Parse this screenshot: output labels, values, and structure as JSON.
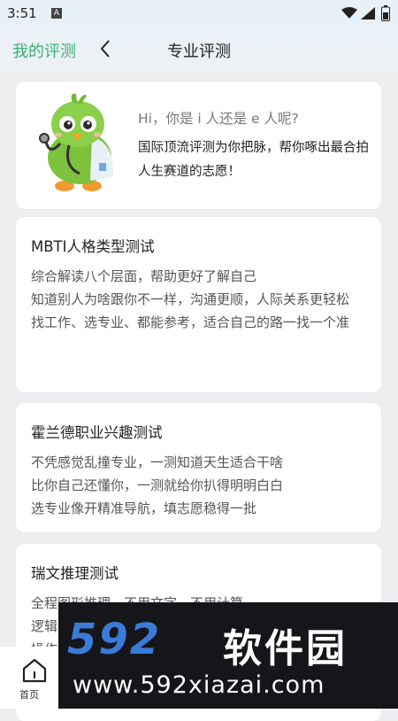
{
  "status_bar": {
    "time": "3:51",
    "a_icon": "A"
  },
  "header": {
    "my_eval": "我的评测",
    "title": "专业评测"
  },
  "intro": {
    "greeting": "Hi，你是 i 人还是 e 人呢?",
    "description": "国际顶流评测为你把脉，帮你啄出最合拍人生赛道的志愿！"
  },
  "tests": [
    {
      "title": "MBTI人格类型测试",
      "lines": [
        "综合解读八个层面，帮助更好了解自己",
        "知道别人为啥跟你不一样，沟通更顺，人际关系更轻松",
        "找工作、选专业、都能参考，适合自己的路一找一个准"
      ]
    },
    {
      "title": "霍兰德职业兴趣测试",
      "lines": [
        "不凭感觉乱撞专业，一测知道天生适合干啥",
        "比你自己还懂你，一测就给你扒得明明白白",
        "选专业像开精准导航，填志愿稳得一批"
      ]
    },
    {
      "title": "瑞文推理测试",
      "lines": [
        "全程图形推理，不用文字，不用计算",
        "逻辑",
        "操作"
      ]
    }
  ],
  "bottom_nav": {
    "home_label": "首页"
  },
  "watermark": {
    "logo": "592",
    "cn": "软件园",
    "url": "www.592xiazai.com"
  },
  "colors": {
    "accent_green": "#3bb074",
    "watermark_blue": "#3a7bd8"
  },
  "icons": [
    "wifi-icon",
    "signal-icon",
    "battery-icon",
    "back-icon",
    "home-icon",
    "mascot-bird"
  ]
}
